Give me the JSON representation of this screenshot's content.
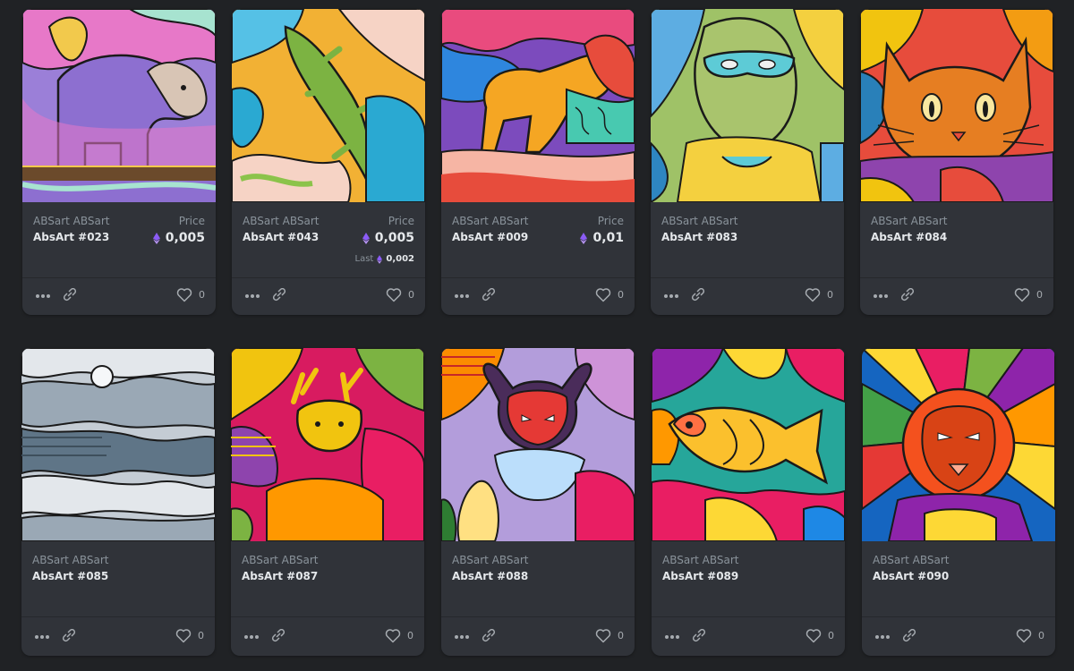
{
  "cards": [
    {
      "collection": "ABSart ABSart",
      "name": "AbsArt #023",
      "price_label": "Price",
      "price": "0,005",
      "likes": "0"
    },
    {
      "collection": "ABSart ABSart",
      "name": "AbsArt #043",
      "price_label": "Price",
      "price": "0,005",
      "last_label": "Last",
      "last_price": "0,002",
      "likes": "0"
    },
    {
      "collection": "ABSart ABSart",
      "name": "AbsArt #009",
      "price_label": "Price",
      "price": "0,01",
      "likes": "0"
    },
    {
      "collection": "ABSart ABSart",
      "name": "AbsArt #083",
      "likes": "0"
    },
    {
      "collection": "ABSart ABSart",
      "name": "AbsArt #084",
      "likes": "0"
    },
    {
      "collection": "ABSart ABSart",
      "name": "AbsArt #085",
      "likes": "0"
    },
    {
      "collection": "ABSart ABSart",
      "name": "AbsArt #087",
      "likes": "0"
    },
    {
      "collection": "ABSart ABSart",
      "name": "AbsArt #088",
      "likes": "0"
    },
    {
      "collection": "ABSart ABSart",
      "name": "AbsArt #089",
      "likes": "0"
    },
    {
      "collection": "ABSart ABSart",
      "name": "AbsArt #090",
      "likes": "0"
    }
  ],
  "colors": {
    "background": "#202225",
    "card": "#303339",
    "text_primary": "#e5e8eb",
    "text_secondary": "#8a939b",
    "eth_accent": "#8b5cf6"
  },
  "icons": {
    "price_currency": "ethereum-icon",
    "more": "more-dots-icon",
    "share": "link-icon",
    "favorite": "heart-icon"
  }
}
